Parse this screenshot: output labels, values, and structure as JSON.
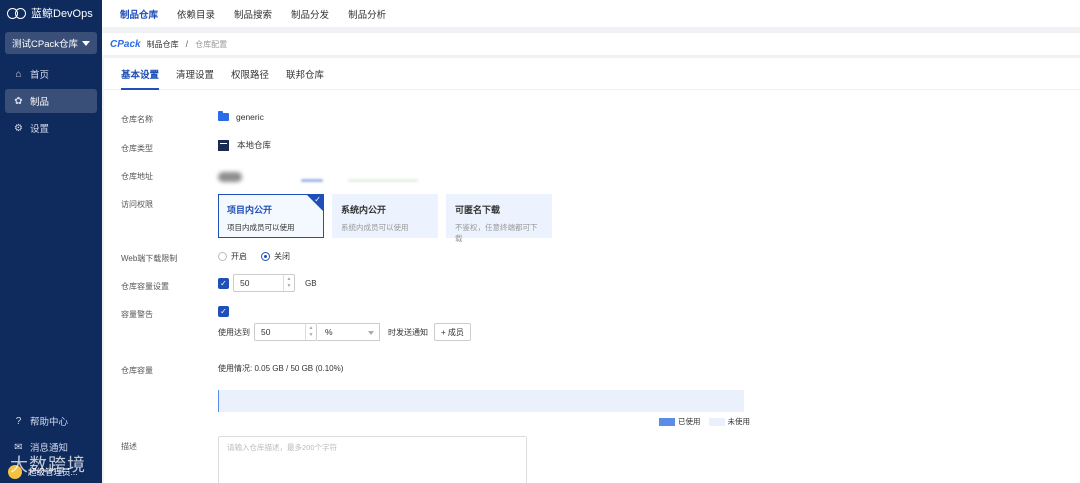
{
  "brand": {
    "name": "蓝鲸DevOps"
  },
  "sidebar": {
    "repo_select": "测试CPack仓库",
    "items": [
      {
        "label": "首页",
        "icon": "home-icon"
      },
      {
        "label": "制品",
        "icon": "artifact-icon",
        "active": true
      },
      {
        "label": "设置",
        "icon": "settings-icon"
      }
    ],
    "bottom": [
      {
        "label": "帮助中心",
        "icon": "help-icon"
      },
      {
        "label": "消息通知",
        "icon": "message-icon"
      }
    ],
    "user": "超级管理员..."
  },
  "topnav": {
    "tabs": [
      "制品仓库",
      "依赖目录",
      "制品搜索",
      "制品分发",
      "制品分析"
    ],
    "active_index": 0
  },
  "breadcrumb": {
    "logo": "CPack",
    "items": [
      "制品仓库",
      "仓库配置"
    ]
  },
  "subtabs": {
    "items": [
      "基本设置",
      "清理设置",
      "权限路径",
      "联邦仓库"
    ],
    "active_index": 0
  },
  "form": {
    "repo_name": {
      "label": "仓库名称",
      "value": "generic"
    },
    "repo_type": {
      "label": "仓库类型",
      "value": "本地仓库"
    },
    "repo_address": {
      "label": "仓库地址"
    },
    "access": {
      "label": "访问权限",
      "options": [
        {
          "title": "项目内公开",
          "desc": "项目内成员可以使用",
          "selected": true
        },
        {
          "title": "系统内公开",
          "desc": "系统内成员可以使用",
          "selected": false
        },
        {
          "title": "可匿名下载",
          "desc": "不鉴权，任意终端都可下载",
          "selected": false
        }
      ]
    },
    "web_download": {
      "label": "Web端下载限制",
      "options": [
        "开启",
        "关闭"
      ],
      "selected_index": 1
    },
    "capacity": {
      "label": "仓库容量设置",
      "checked": true,
      "value": "50",
      "unit": "GB"
    },
    "capacity_alert": {
      "label": "容量警告",
      "checked": true,
      "prefix": "使用达到",
      "value": "50",
      "unit": "%",
      "suffix": "时发送通知",
      "add_member_label": "+ 成员"
    },
    "usage": {
      "label": "仓库容量",
      "text": "使用情况: 0.05 GB / 50 GB (0.10%)",
      "used_fraction": 0.001,
      "legend_used": "已使用",
      "legend_unused": "未使用"
    },
    "description": {
      "label": "描述",
      "placeholder": "请输入仓库描述，最多200个字符"
    }
  },
  "watermark": "大数跨境",
  "colors": {
    "sidebar": "#0f2a5c",
    "accent": "#1f4fb8",
    "used": "#5b8ce8",
    "unused": "#eaf1fd"
  }
}
